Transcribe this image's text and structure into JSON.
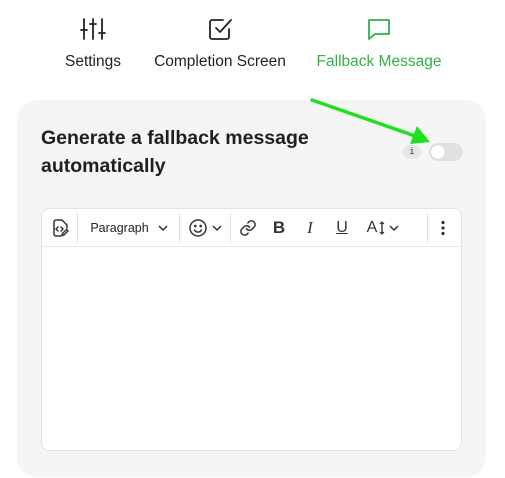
{
  "tabs": [
    {
      "label": "Settings",
      "icon": "sliders-icon"
    },
    {
      "label": "Completion Screen",
      "icon": "check-square-icon"
    },
    {
      "label": "Fallback Message",
      "icon": "message-square-icon",
      "active": true
    }
  ],
  "card": {
    "title": "Generate a fallback message automatically",
    "info_badge": "i",
    "toggle_on": false
  },
  "editor": {
    "paragraph_label": "Paragraph",
    "bold": "B",
    "italic": "I",
    "underline": "U",
    "font_size": "A",
    "body_text": ""
  },
  "colors": {
    "accent": "#35b04a",
    "arrow": "#1fe01f",
    "card_bg": "#f5f5f5"
  }
}
